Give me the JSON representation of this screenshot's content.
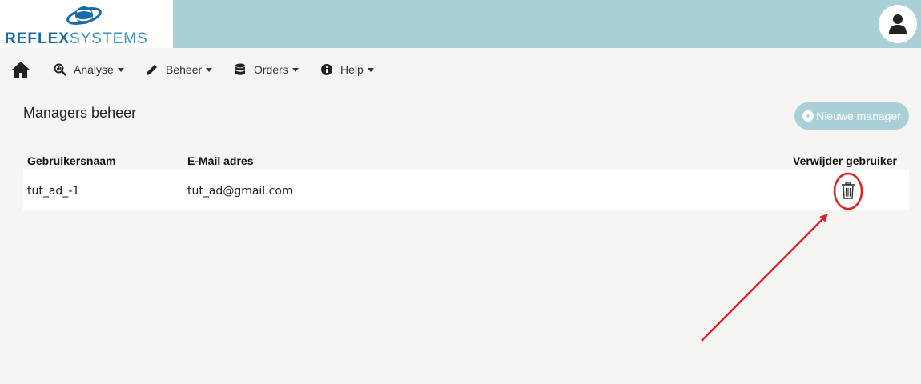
{
  "brand": {
    "logo_reflex": "REFLEX",
    "logo_systems": "SYSTEMS",
    "logo_globe_color": "#1a6aa8"
  },
  "header": {
    "accent_color": "#a9d0d6",
    "user_icon": "user-icon"
  },
  "nav": {
    "home_icon": "home-icon",
    "items": [
      {
        "label": "Analyse",
        "icon": "search-chart-icon"
      },
      {
        "label": "Beheer",
        "icon": "pencil-icon"
      },
      {
        "label": "Orders",
        "icon": "database-icon"
      },
      {
        "label": "Help",
        "icon": "info-icon"
      }
    ]
  },
  "main": {
    "title": "Managers beheer",
    "new_button_label": "Nieuwe manager",
    "table": {
      "columns": [
        "Gebruikersnaam",
        "E-Mail adres",
        "Verwijder gebruiker"
      ],
      "rows": [
        {
          "username": "tut_ad_-1",
          "email": "tut_ad@gmail.com",
          "delete_icon": "trash-icon"
        }
      ]
    }
  },
  "annotation": {
    "color": "#e02020"
  }
}
